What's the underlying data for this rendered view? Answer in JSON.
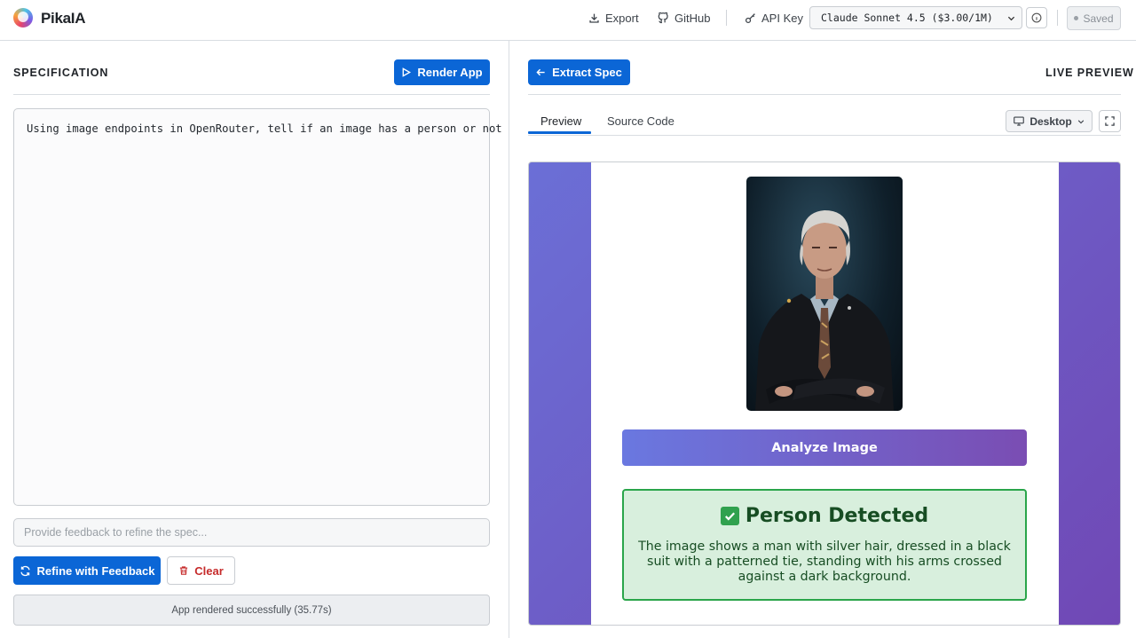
{
  "app": {
    "name": "PikaIA"
  },
  "topbar": {
    "export_label": "Export",
    "github_label": "GitHub",
    "api_key_label": "API Key",
    "model_selected": "Claude Sonnet 4.5 ($3.00/1M)",
    "saved_label": "Saved"
  },
  "spec": {
    "title": "SPECIFICATION",
    "render_label": "Render App",
    "text": "Using image endpoints in OpenRouter, tell if an image has a person or not",
    "feedback_placeholder": "Provide feedback to refine the spec...",
    "refine_label": "Refine with Feedback",
    "clear_label": "Clear",
    "status": "App rendered successfully (35.77s)"
  },
  "preview": {
    "extract_label": "Extract Spec",
    "title": "LIVE PREVIEW",
    "tabs": [
      {
        "label": "Preview"
      },
      {
        "label": "Source Code"
      }
    ],
    "device_label": "Desktop",
    "app": {
      "analyze_label": "Analyze Image",
      "result_emoji": "✅",
      "result_title": "Person Detected",
      "result_description": "The image shows a man with silver hair, dressed in a black suit with a patterned tie, standing with his arms crossed against a dark background."
    }
  },
  "colors": {
    "primary": "#0b66d6",
    "danger": "#c62b2b",
    "success_border": "#2aa54a",
    "success_bg": "#d8efdd",
    "gradient_start": "#6a78e0",
    "gradient_end": "#7a4db3"
  },
  "icons": [
    "export-icon",
    "github-icon",
    "key-icon",
    "chevron-down-icon",
    "info-icon",
    "play-icon",
    "arrow-left-icon",
    "monitor-icon",
    "fullscreen-icon",
    "refresh-icon",
    "trash-icon",
    "check-icon"
  ]
}
